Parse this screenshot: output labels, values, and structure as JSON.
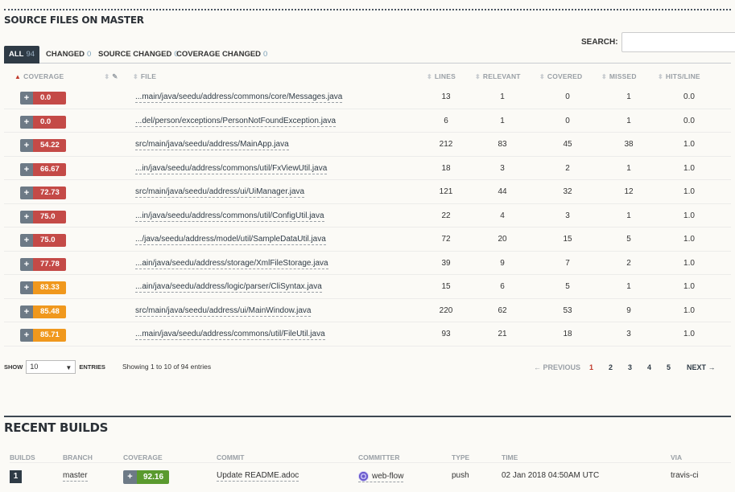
{
  "source_files": {
    "title": "SOURCE FILES ON MASTER",
    "search_label": "SEARCH:",
    "search_value": "",
    "tabs": [
      {
        "label": "ALL",
        "count": "94"
      },
      {
        "label": "CHANGED",
        "count": "0"
      },
      {
        "label": "SOURCE CHANGED",
        "count": "0"
      },
      {
        "label": "COVERAGE CHANGED",
        "count": "0"
      }
    ],
    "columns": {
      "coverage": "COVERAGE",
      "file": "FILE",
      "lines": "LINES",
      "relevant": "RELEVANT",
      "covered": "COVERED",
      "missed": "MISSED",
      "hits": "HITS/LINE"
    },
    "rows": [
      {
        "coverage": "0.0",
        "file": "...main/java/seedu/address/commons/core/Messages.java",
        "lines": "13",
        "relevant": "1",
        "covered": "0",
        "missed": "1",
        "hits": "0.0"
      },
      {
        "coverage": "0.0",
        "file": "...del/person/exceptions/PersonNotFoundException.java",
        "lines": "6",
        "relevant": "1",
        "covered": "0",
        "missed": "1",
        "hits": "0.0"
      },
      {
        "coverage": "54.22",
        "file": "src/main/java/seedu/address/MainApp.java",
        "lines": "212",
        "relevant": "83",
        "covered": "45",
        "missed": "38",
        "hits": "1.0"
      },
      {
        "coverage": "66.67",
        "file": "...in/java/seedu/address/commons/util/FxViewUtil.java",
        "lines": "18",
        "relevant": "3",
        "covered": "2",
        "missed": "1",
        "hits": "1.0"
      },
      {
        "coverage": "72.73",
        "file": "src/main/java/seedu/address/ui/UiManager.java",
        "lines": "121",
        "relevant": "44",
        "covered": "32",
        "missed": "12",
        "hits": "1.0"
      },
      {
        "coverage": "75.0",
        "file": "...in/java/seedu/address/commons/util/ConfigUtil.java",
        "lines": "22",
        "relevant": "4",
        "covered": "3",
        "missed": "1",
        "hits": "1.0"
      },
      {
        "coverage": "75.0",
        "file": ".../java/seedu/address/model/util/SampleDataUtil.java",
        "lines": "72",
        "relevant": "20",
        "covered": "15",
        "missed": "5",
        "hits": "1.0"
      },
      {
        "coverage": "77.78",
        "file": "...ain/java/seedu/address/storage/XmlFileStorage.java",
        "lines": "39",
        "relevant": "9",
        "covered": "7",
        "missed": "2",
        "hits": "1.0"
      },
      {
        "coverage": "83.33",
        "file": "...ain/java/seedu/address/logic/parser/CliSyntax.java",
        "lines": "15",
        "relevant": "6",
        "covered": "5",
        "missed": "1",
        "hits": "1.0"
      },
      {
        "coverage": "85.48",
        "file": "src/main/java/seedu/address/ui/MainWindow.java",
        "lines": "220",
        "relevant": "62",
        "covered": "53",
        "missed": "9",
        "hits": "1.0"
      },
      {
        "coverage": "85.71",
        "file": "...main/java/seedu/address/commons/util/FileUtil.java",
        "lines": "93",
        "relevant": "21",
        "covered": "18",
        "missed": "3",
        "hits": "1.0"
      }
    ],
    "footer": {
      "show_label": "SHOW",
      "entries_value": "10",
      "entries_label": "ENTRIES",
      "info": "Showing 1 to 10 of 94 entries"
    },
    "pager": {
      "previous": "← PREVIOUS",
      "pages": [
        "1",
        "2",
        "3",
        "4",
        "5"
      ],
      "current": "1",
      "next": "NEXT →"
    }
  },
  "recent_builds": {
    "title": "RECENT BUILDS",
    "columns": {
      "builds": "BUILDS",
      "branch": "BRANCH",
      "coverage": "COVERAGE",
      "commit": "COMMIT",
      "committer": "COMMITTER",
      "type": "TYPE",
      "time": "TIME",
      "via": "VIA"
    },
    "rows": [
      {
        "build": "1",
        "branch": "master",
        "coverage": "92.16",
        "commit": "Update README.adoc",
        "committer": "web-flow",
        "type": "push",
        "time": "02 Jan 2018 04:50AM UTC",
        "via": "travis-ci"
      }
    ]
  },
  "colors": {
    "red": "#c44a47",
    "orange": "#f0981d",
    "green": "#5a9a2e",
    "dark": "#2f3b46"
  }
}
